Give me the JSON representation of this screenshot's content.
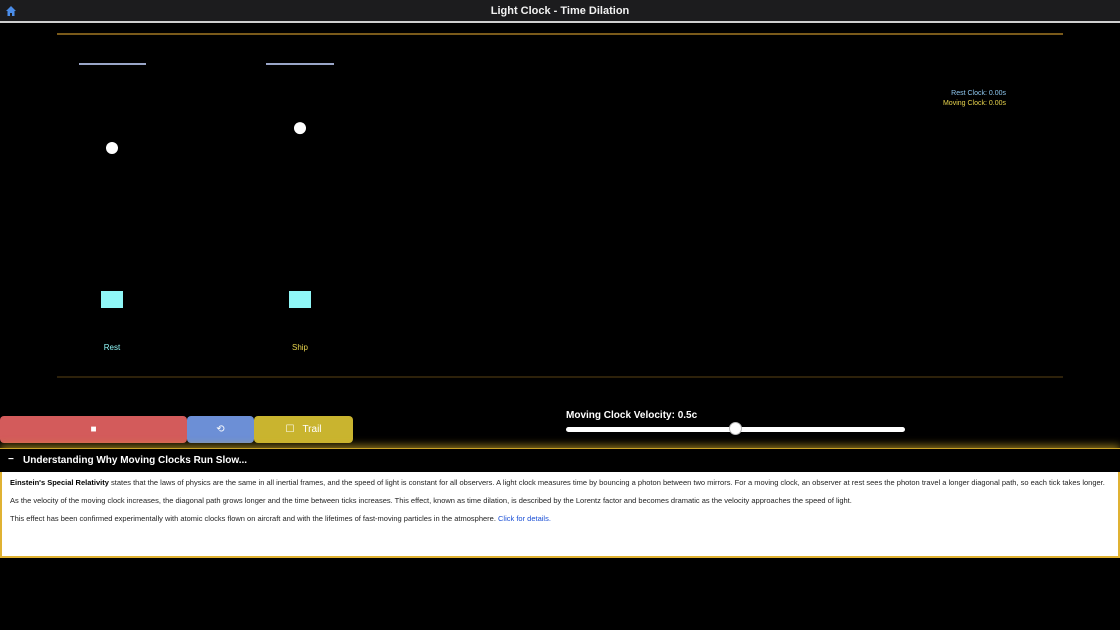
{
  "window": {
    "title": "Light Clock - Time Dilation",
    "home_icon": "home-icon"
  },
  "simulation": {
    "clock_labels": [
      "Rest",
      "Ship"
    ],
    "legend": [
      "Rest Clock: 0.00s",
      "Moving Clock: 0.00s"
    ],
    "colors": {
      "frame_line": "#7a5a1a",
      "mirror": "#9aa6c8",
      "photon": "#ffffff",
      "emitter": "#8ff7f7",
      "rest_label": "#8ff7f7",
      "moving_label": "#e8d44d",
      "legend_rest": "#8fc8f0",
      "legend_moving": "#e8d44d"
    },
    "photon_progress": [
      0.47,
      0.4
    ]
  },
  "controls": {
    "stop_icon": "■",
    "reset_icon": "⟲",
    "trail_icon": "☐",
    "trail_label": "Trail",
    "velocity_label": "Moving Clock Velocity: 0.5c",
    "velocity_value": 0.5,
    "velocity_max": 1.0
  },
  "info": {
    "toggle": "−",
    "heading": "Understanding Why Moving Clocks Run Slow...",
    "para1_bold": "Einstein's Special Relativity",
    "para1": " states that the laws of physics are the same in all inertial frames, and the speed of light is constant for all observers. A light clock measures time by bouncing a photon between two mirrors. For a moving clock, an observer at rest sees the photon travel a longer diagonal path, so each tick takes longer.",
    "para2": "As the velocity of the moving clock increases, the diagonal path grows longer and the time between ticks increases. This effect, known as time dilation, is described by the Lorentz factor and becomes dramatic as the velocity approaches the speed of light.",
    "para3_pre": "This effect has been confirmed experimentally with atomic clocks flown on aircraft and with the lifetimes of fast-moving particles in the atmosphere. ",
    "para3_link": "Click for details."
  }
}
